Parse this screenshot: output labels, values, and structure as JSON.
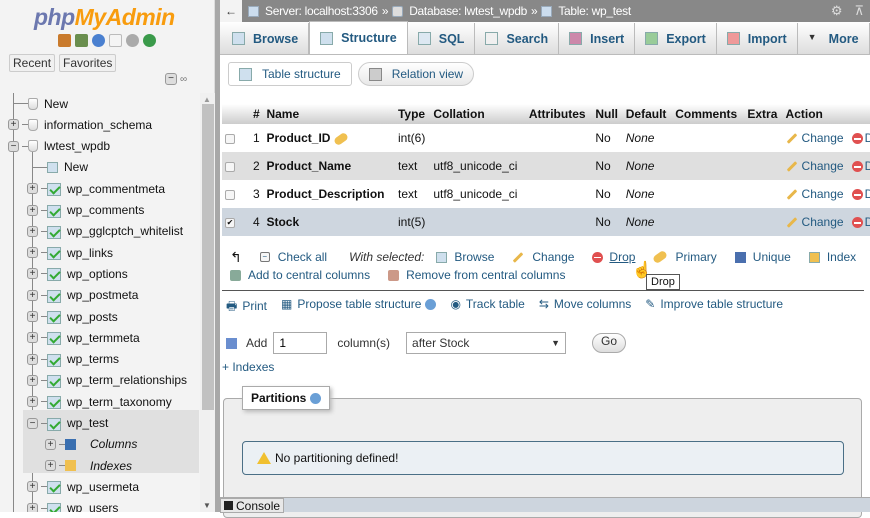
{
  "logo": {
    "part1": "php",
    "part2": "MyAdmin"
  },
  "nav": {
    "icons": [
      "home-icon",
      "logout-icon",
      "help-icon",
      "docs-icon",
      "settings-icon",
      "reload-icon"
    ],
    "recent_label": "Recent",
    "favorites_label": "Favorites",
    "tree": [
      {
        "label": "New",
        "level": 0,
        "type": "new-db"
      },
      {
        "label": "information_schema",
        "level": 0,
        "type": "db",
        "expanded": false
      },
      {
        "label": "lwtest_wpdb",
        "level": 0,
        "type": "db",
        "expanded": true
      },
      {
        "label": "New",
        "level": 1,
        "type": "new-table"
      },
      {
        "label": "wp_commentmeta",
        "level": 1,
        "type": "table"
      },
      {
        "label": "wp_comments",
        "level": 1,
        "type": "table"
      },
      {
        "label": "wp_gglcptch_whitelist",
        "level": 1,
        "type": "table"
      },
      {
        "label": "wp_links",
        "level": 1,
        "type": "table"
      },
      {
        "label": "wp_options",
        "level": 1,
        "type": "table"
      },
      {
        "label": "wp_postmeta",
        "level": 1,
        "type": "table"
      },
      {
        "label": "wp_posts",
        "level": 1,
        "type": "table"
      },
      {
        "label": "wp_termmeta",
        "level": 1,
        "type": "table"
      },
      {
        "label": "wp_terms",
        "level": 1,
        "type": "table"
      },
      {
        "label": "wp_term_relationships",
        "level": 1,
        "type": "table"
      },
      {
        "label": "wp_term_taxonomy",
        "level": 1,
        "type": "table"
      },
      {
        "label": "wp_test",
        "level": 1,
        "type": "table",
        "expanded": true,
        "selected": true
      },
      {
        "label": "Columns",
        "level": 2,
        "type": "columns"
      },
      {
        "label": "Indexes",
        "level": 2,
        "type": "indexes"
      },
      {
        "label": "wp_usermeta",
        "level": 1,
        "type": "table"
      },
      {
        "label": "wp_users",
        "level": 1,
        "type": "table"
      }
    ]
  },
  "breadcrumb": {
    "server": "Server: localhost:3306",
    "database": "Database: lwtest_wpdb",
    "table": "Table: wp_test",
    "sep": "»"
  },
  "tabs": [
    {
      "label": "Browse",
      "icon": "browse-icon"
    },
    {
      "label": "Structure",
      "icon": "structure-icon",
      "active": true
    },
    {
      "label": "SQL",
      "icon": "sql-icon"
    },
    {
      "label": "Search",
      "icon": "search-icon"
    },
    {
      "label": "Insert",
      "icon": "insert-icon"
    },
    {
      "label": "Export",
      "icon": "export-icon"
    },
    {
      "label": "Import",
      "icon": "import-icon"
    },
    {
      "label": "More",
      "icon": "caret-down-icon"
    }
  ],
  "subtabs": {
    "table_structure": "Table structure",
    "relation_view": "Relation view"
  },
  "table": {
    "headers": [
      "",
      "#",
      "Name",
      "Type",
      "Collation",
      "Attributes",
      "Null",
      "Default",
      "Comments",
      "Extra",
      "Action"
    ],
    "rows": [
      {
        "num": "1",
        "name": "Product_ID",
        "primary": true,
        "type": "int(6)",
        "collation": "",
        "attributes": "",
        "null": "No",
        "default": "None",
        "comments": "",
        "extra": "",
        "checked": false
      },
      {
        "num": "2",
        "name": "Product_Name",
        "primary": false,
        "type": "text",
        "collation": "utf8_unicode_ci",
        "attributes": "",
        "null": "No",
        "default": "None",
        "comments": "",
        "extra": "",
        "checked": false
      },
      {
        "num": "3",
        "name": "Product_Description",
        "primary": false,
        "type": "text",
        "collation": "utf8_unicode_ci",
        "attributes": "",
        "null": "No",
        "default": "None",
        "comments": "",
        "extra": "",
        "checked": false
      },
      {
        "num": "4",
        "name": "Stock",
        "primary": false,
        "type": "int(5)",
        "collation": "",
        "attributes": "",
        "null": "No",
        "default": "None",
        "comments": "",
        "extra": "",
        "checked": true
      }
    ],
    "action_change": "Change",
    "action_drop": "D"
  },
  "bulk": {
    "check_all": "Check all",
    "with_selected": "With selected:",
    "browse": "Browse",
    "change": "Change",
    "drop": "Drop",
    "primary": "Primary",
    "unique": "Unique",
    "index": "Index",
    "add_central": "Add to central columns",
    "remove_central": "Remove from central columns"
  },
  "tooltip": "Drop",
  "tools": {
    "print": "Print",
    "propose": "Propose table structure",
    "track": "Track table",
    "move": "Move columns",
    "improve": "Improve table structure"
  },
  "addcol": {
    "label": "Add",
    "count": "1",
    "unit": "column(s)",
    "position": "after Stock",
    "go": "Go"
  },
  "indexes_link": "+ Indexes",
  "partitions": {
    "title": "Partitions",
    "notice": "No partitioning defined!"
  },
  "console": "Console"
}
